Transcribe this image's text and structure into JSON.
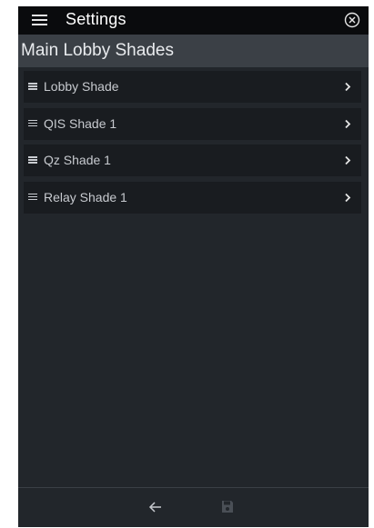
{
  "header": {
    "title": "Settings",
    "menu_icon": "hamburger-menu-icon",
    "close_icon": "close-circle-icon"
  },
  "subheader": {
    "title": "Main Lobby Shades"
  },
  "shades": [
    {
      "label": "Lobby Shade"
    },
    {
      "label": "QIS Shade 1"
    },
    {
      "label": "Qz Shade 1"
    },
    {
      "label": "Relay Shade 1"
    }
  ],
  "footer": {
    "back_icon": "arrow-left-icon",
    "save_icon": "save-floppy-icon"
  },
  "colors": {
    "topbar": "#0a0b0d",
    "subheader": "#3b4046",
    "panel": "#22262b",
    "list_item": "#191c20",
    "text": "#c7cacf"
  }
}
